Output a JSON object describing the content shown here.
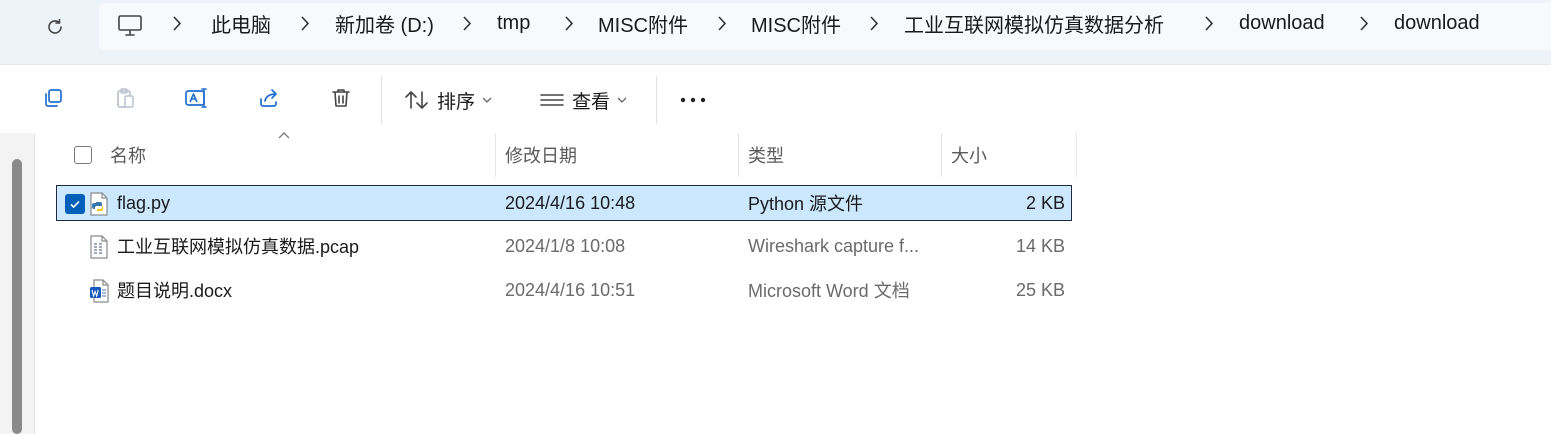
{
  "address_bar": {
    "breadcrumbs": [
      "此电脑",
      "新加卷 (D:)",
      "tmp",
      "MISC附件",
      "MISC附件",
      "工业互联网模拟仿真数据分析",
      "download",
      "download"
    ]
  },
  "toolbar": {
    "sort_label": "排序",
    "view_label": "查看"
  },
  "columns": {
    "name": "名称",
    "modified": "修改日期",
    "type": "类型",
    "size": "大小"
  },
  "files": [
    {
      "name": "flag.py",
      "modified": "2024/4/16 10:48",
      "type": "Python 源文件",
      "size": "2 KB",
      "selected": true,
      "icon": "python-file-icon"
    },
    {
      "name": "工业互联网模拟仿真数据.pcap",
      "modified": "2024/1/8 10:08",
      "type": "Wireshark capture f...",
      "size": "14 KB",
      "selected": false,
      "icon": "pcap-file-icon"
    },
    {
      "name": "题目说明.docx",
      "modified": "2024/4/16 10:51",
      "type": "Microsoft Word 文档",
      "size": "25 KB",
      "selected": false,
      "icon": "word-file-icon"
    }
  ],
  "colors": {
    "accent": "#005fb8",
    "selection": "#cce8ff",
    "topbar": "#eef3f9"
  }
}
